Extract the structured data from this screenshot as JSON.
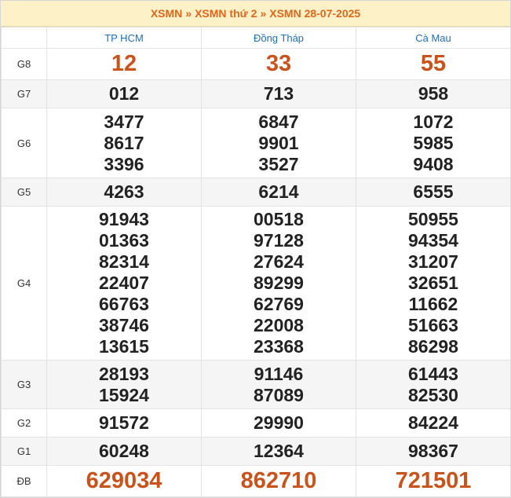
{
  "breadcrumb": {
    "item1": "XSMN",
    "item2": "XSMN thứ 2",
    "item3": "XSMN 28-07-2025",
    "separator": "»"
  },
  "provinces": [
    "TP HCM",
    "Đồng Tháp",
    "Cà Mau"
  ],
  "prizes": [
    {
      "label": "G8",
      "results": [
        [
          "12"
        ],
        [
          "33"
        ],
        [
          "55"
        ]
      ]
    },
    {
      "label": "G7",
      "results": [
        [
          "012"
        ],
        [
          "713"
        ],
        [
          "958"
        ]
      ]
    },
    {
      "label": "G6",
      "results": [
        [
          "3477",
          "8617",
          "3396"
        ],
        [
          "6847",
          "9901",
          "3527"
        ],
        [
          "1072",
          "5985",
          "9408"
        ]
      ]
    },
    {
      "label": "G5",
      "results": [
        [
          "4263"
        ],
        [
          "6214"
        ],
        [
          "6555"
        ]
      ]
    },
    {
      "label": "G4",
      "results": [
        [
          "91943",
          "01363",
          "82314",
          "22407",
          "66763",
          "38746",
          "13615"
        ],
        [
          "00518",
          "97128",
          "27624",
          "89299",
          "62769",
          "22008",
          "23368"
        ],
        [
          "50955",
          "94354",
          "31207",
          "32651",
          "11662",
          "51663",
          "86298"
        ]
      ]
    },
    {
      "label": "G3",
      "results": [
        [
          "28193",
          "15924"
        ],
        [
          "91146",
          "87089"
        ],
        [
          "61443",
          "82530"
        ]
      ]
    },
    {
      "label": "G2",
      "results": [
        [
          "91572"
        ],
        [
          "29990"
        ],
        [
          "84224"
        ]
      ]
    },
    {
      "label": "G1",
      "results": [
        [
          "60248"
        ],
        [
          "12364"
        ],
        [
          "98367"
        ]
      ]
    },
    {
      "label": "ĐB",
      "results": [
        [
          "629034"
        ],
        [
          "862710"
        ],
        [
          "721501"
        ]
      ]
    }
  ],
  "colors": {
    "accent": "#e0661b",
    "header_bg": "#fdf1c8",
    "province": "#1f6fb7",
    "highlight_number": "#c9531a"
  }
}
